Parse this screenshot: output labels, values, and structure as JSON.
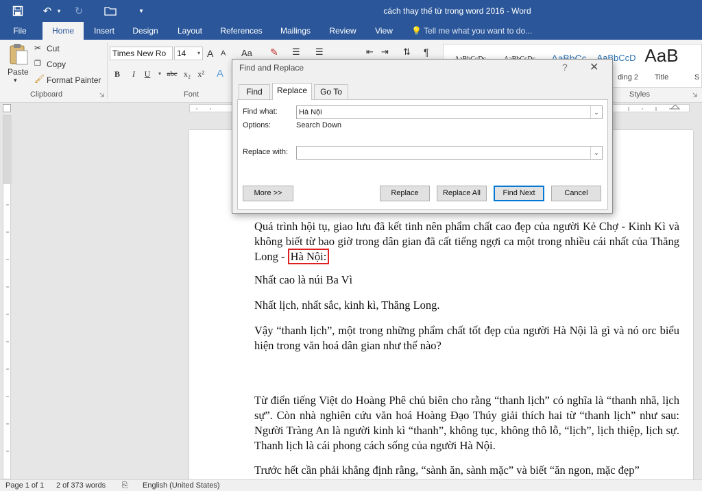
{
  "window": {
    "title": "cách thay thế từ trong word 2016 - Word"
  },
  "ribbon_tabs": [
    "File",
    "Home",
    "Insert",
    "Design",
    "Layout",
    "References",
    "Mailings",
    "Review",
    "View"
  ],
  "tell_me": "Tell me what you want to do...",
  "clipboard": {
    "paste": "Paste",
    "cut": "Cut",
    "copy": "Copy",
    "format_painter": "Format Painter",
    "group_label": "Clipboard"
  },
  "font": {
    "name": "Times New Ro",
    "size": "14",
    "group_label": "Font",
    "grow": "A",
    "shrink": "A",
    "case": "Aa",
    "bold": "B",
    "italic": "I",
    "underline": "U",
    "strike": "abc",
    "subscript": "x₂",
    "superscript": "x²"
  },
  "styles": {
    "group_label": "Styles",
    "previews": [
      "AaBbCcDc",
      "AaBbCcDc",
      "AaBbCc",
      "AaBbCcD",
      "AaB"
    ],
    "names": [
      "ding 2",
      "Title",
      "S"
    ]
  },
  "document": {
    "paragraphs": [
      {
        "before": "Quá trình hội tụ, giao lưu đã kết tinh nên phẩm chất cao đẹp của người Kẻ Chợ -  Kinh Kì và không biết từ bao giờ trong dân gian đã cất tiếng ngợi ca một trong nhiều cái nhất của Thăng Long - ",
        "highlight": "Hà Nội:"
      },
      {
        "text": "Nhất cao là núi Ba Vì"
      },
      {
        "text": "Nhất lịch, nhất sắc, kinh kì, Thăng Long."
      },
      {
        "text": "Vậy “thanh lịch”, một trong những phẩm chất tốt đẹp của người Hà Nội là gì và nó orc biểu hiện trong văn hoá dân gian như thế nào?"
      },
      {
        "text": "Từ điển tiếng Việt do Hoàng Phê chủ biên cho rằng “thanh lịch” có nghĩa là “thanh nhã, lịch sự”. Còn nhà nghiên cứu văn hoá Hoàng Đạo Thúy giải thích hai từ “thanh lịch” như sau: Người Tràng An là người kinh kì “thanh”, không tục, không thô lỗ, “lịch”, lịch thiệp, lịch sự. Thanh lịch là cái phong cách sống của người Hà Nội."
      },
      {
        "text": "Trước hết cần phải khẳng định rằng, “sành ăn, sành mặc” và biết “ăn ngon, mặc đẹp”"
      }
    ]
  },
  "status": {
    "page": "Page 1 of 1",
    "words": "2 of 373 words",
    "language": "English (United States)"
  },
  "dialog": {
    "title": "Find and Replace",
    "help": "?",
    "tabs": [
      "Find",
      "Replace",
      "Go To"
    ],
    "find_label": "Find what:",
    "find_value": "Hà Nội",
    "options_label": "Options:",
    "options_value": "Search Down",
    "replace_label": "Replace with:",
    "replace_value": "",
    "buttons": {
      "more": "More >>",
      "replace": "Replace",
      "replace_all": "Replace All",
      "find_next": "Find Next",
      "cancel": "Cancel"
    }
  },
  "colors": {
    "word_blue": "#2b579a",
    "highlight_box": "#e02020",
    "focus_button": "#0078d7"
  }
}
